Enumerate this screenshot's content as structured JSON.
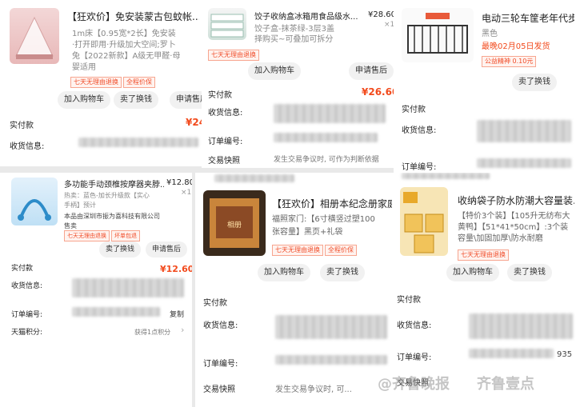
{
  "top_left": {
    "title": "【狂欢价】免安装蒙古包蚊帐...",
    "specs": [
      "1m床【0.95宽*2长】免安装",
      "·打开即用·升级加大空间;罗卜",
      "兔【2022新款】A级无甲醛·母",
      "婴适用"
    ],
    "tags": [
      "七天无理由退换",
      "全程价保"
    ],
    "buttons": [
      "加入购物车",
      "卖了换钱",
      "申请售后"
    ],
    "fields": [
      {
        "label": "实付款",
        "value": "¥24"
      },
      {
        "label": "收货信息:",
        "value": ""
      }
    ]
  },
  "top_middle": {
    "title": "饺子收纳盒冰箱用食品级水...",
    "price": "¥28.60",
    "qty": "×1",
    "specs": [
      "饺子盒-抹茶绿-3层3盖",
      "择购买~可叠加可拆分"
    ],
    "tags": [
      "七天无理由退换"
    ],
    "buttons": [
      "加入购物车",
      "申请售后"
    ],
    "fields": [
      {
        "label": "实付款",
        "value": "¥26.60"
      },
      {
        "label": "收货信息:",
        "value": ""
      },
      {
        "label": "订单编号:",
        "value": ""
      },
      {
        "label": "交易快照",
        "value": "发生交易争议时, 可作为判断依据"
      }
    ]
  },
  "top_right": {
    "badge": "",
    "title": "电动三轮车筐老年代步车篮...",
    "color": "黑色",
    "delivery": "最晚02月05日发货",
    "insurance": "公益精神 0.10元",
    "buttons": [
      "卖了换钱"
    ],
    "fields": [
      {
        "label": "实付款",
        "value": ""
      },
      {
        "label": "收货信息:",
        "value": ""
      },
      {
        "label": "订单编号:",
        "value": ""
      }
    ]
  },
  "bottom_left": {
    "title": "多功能手动颈椎按摩器夹脖...",
    "price": "¥12.80",
    "qty": "×1",
    "specs": [
      "热卖：蓝色-加长升级款【实心",
      "手柄】预计",
      "本品由深圳市振为喜科技有限公司",
      "售卖"
    ],
    "tags": [
      "七天无理由退换",
      "坏单包退"
    ],
    "buttons": [
      "卖了换钱",
      "申请售后"
    ],
    "fields": [
      {
        "label": "实付款",
        "value": "¥12.60"
      },
      {
        "label": "收货信息:",
        "value": ""
      },
      {
        "label": "订单编号:",
        "value": "复制"
      },
      {
        "label": "天猫积分:",
        "value": "获得1点积分"
      }
    ]
  },
  "bottom_middle": {
    "title": "【狂欢价】相册本纪念册家庭...",
    "specs": [
      "福照家门:【6寸横竖过塑100",
      "张容量】黑页+礼袋"
    ],
    "tags": [
      "七天无理由退换",
      "全程价保"
    ],
    "buttons": [
      "加入购物车",
      "卖了换钱"
    ],
    "fields": [
      {
        "label": "实付款",
        "value": ""
      },
      {
        "label": "收货信息:",
        "value": ""
      },
      {
        "label": "订单编号:",
        "value": ""
      },
      {
        "label": "交易快照",
        "value": "发生交易争议时, 可..."
      }
    ]
  },
  "bottom_right": {
    "title": "收纳袋子防水防潮大容量装...",
    "specs": [
      "【特价3个装】【105升无纺布大",
      "黄鸭】【51*41*50cm】:3个装",
      "容量\\加固加厚\\防水耐磨"
    ],
    "tags": [
      "七天无理由退换"
    ],
    "buttons": [
      "加入购物车",
      "卖了换钱"
    ],
    "fields": [
      {
        "label": "实付款",
        "value": ""
      },
      {
        "label": "收货信息:",
        "value": ""
      },
      {
        "label": "订单编号:",
        "value": "935"
      },
      {
        "label": "交易快照",
        "value": ""
      }
    ]
  },
  "watermark": [
    "@齐鲁晚报",
    "齐鲁壹点"
  ],
  "colors": {
    "accent": "#f24a1c",
    "tag_border": "#f7a58f",
    "button_bg": "#f1f1f1"
  }
}
